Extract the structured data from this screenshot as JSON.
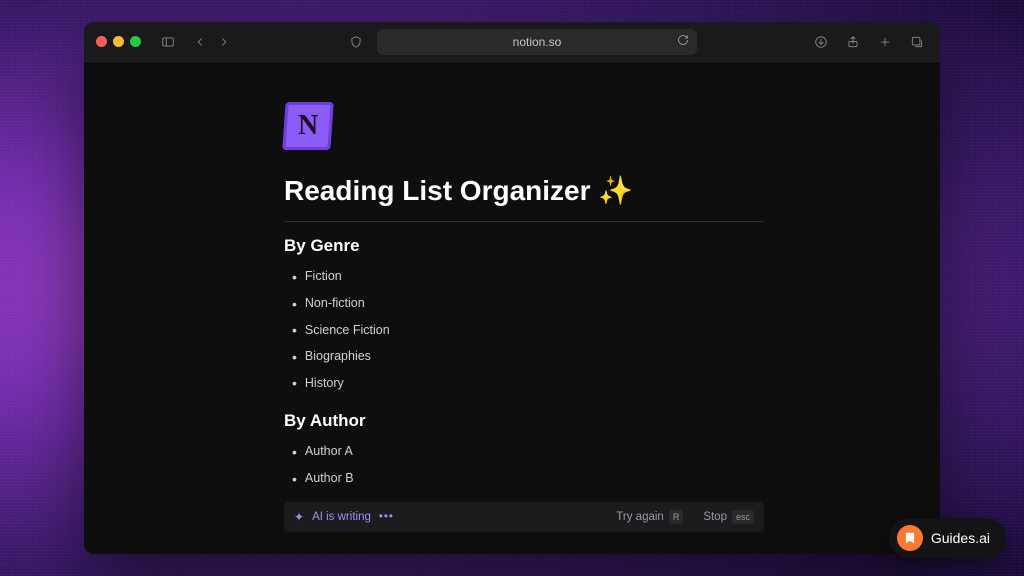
{
  "browser": {
    "url_display": "notion.so"
  },
  "page": {
    "title": "Reading List Organizer ✨",
    "sections": [
      {
        "heading": "By Genre",
        "items": [
          "Fiction",
          "Non-fiction",
          "Science Fiction",
          "Biographies",
          "History"
        ]
      },
      {
        "heading": "By Author",
        "items": [
          "Author A",
          "Author B"
        ]
      }
    ]
  },
  "ai_bar": {
    "status": "AI is writing",
    "try_again": "Try again",
    "try_again_key": "R",
    "stop": "Stop",
    "stop_key": "esc"
  },
  "guides_pill": {
    "label": "Guides.ai"
  },
  "logo_letter": "N"
}
